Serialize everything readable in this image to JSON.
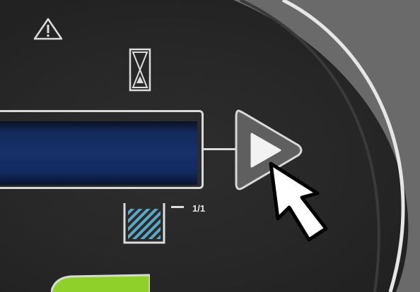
{
  "display": {
    "lcd_text": ""
  },
  "controls": {
    "play_button": "play-triangle-icon"
  },
  "level_indicator": {
    "ratio_label": "1/1",
    "fill_level": 1.0
  },
  "icons": {
    "warning": "warning-triangle-icon",
    "timer": "hourglass-icon",
    "level": "container-level-icon",
    "pointer": "arrow-pointer-icon"
  },
  "colors": {
    "panel": "#262626",
    "lcd": "#16306a",
    "outline": "#d9d9d9",
    "button": "#5f5f5f",
    "accent_green": "#8fd12a",
    "hatch": "#5aa8c8"
  }
}
